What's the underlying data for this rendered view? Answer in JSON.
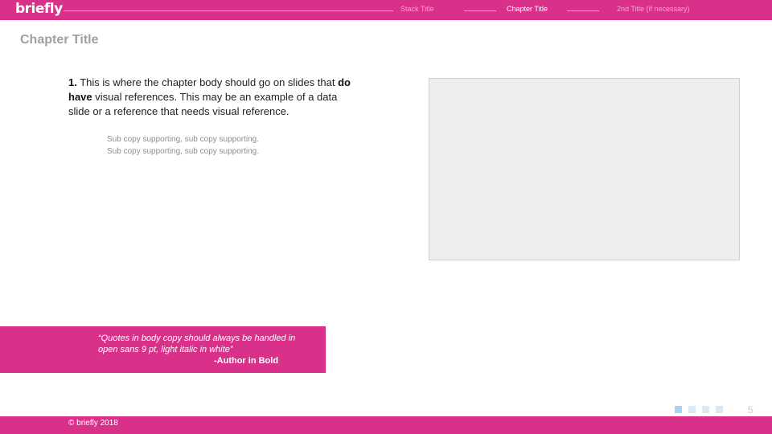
{
  "header": {
    "logo_text": "briefly",
    "nav": {
      "stack_title": "Stack Title",
      "chapter_title": "Chapter Title",
      "second_title": "2nd Title (if necessary)"
    }
  },
  "slide": {
    "chapter_title": "Chapter Title",
    "body": {
      "number": "1.",
      "text_before_bold": " This is where the chapter body should go on slides that ",
      "bold": "do have",
      "text_after_bold": " visual references. This may be an example of a data slide or a reference that needs visual reference."
    },
    "sub_copy": [
      "Sub copy supporting, sub copy supporting.",
      "Sub copy supporting, sub copy supporting."
    ],
    "quote": {
      "text": "“Quotes in body copy should always be handled in open sans 9 pt, light italic in white”",
      "author": "-Author in Bold"
    }
  },
  "pagination": {
    "page_number": "5",
    "indicator_colors": [
      "#a8d4ef",
      "#d8eaf7",
      "#d8eaf7",
      "#d8eaf7"
    ]
  },
  "footer": {
    "copyright": "© briefly 2018"
  },
  "colors": {
    "brand": "#d9318a",
    "title_gray": "#a0a0a0",
    "placeholder_fill": "#eeeeee"
  }
}
